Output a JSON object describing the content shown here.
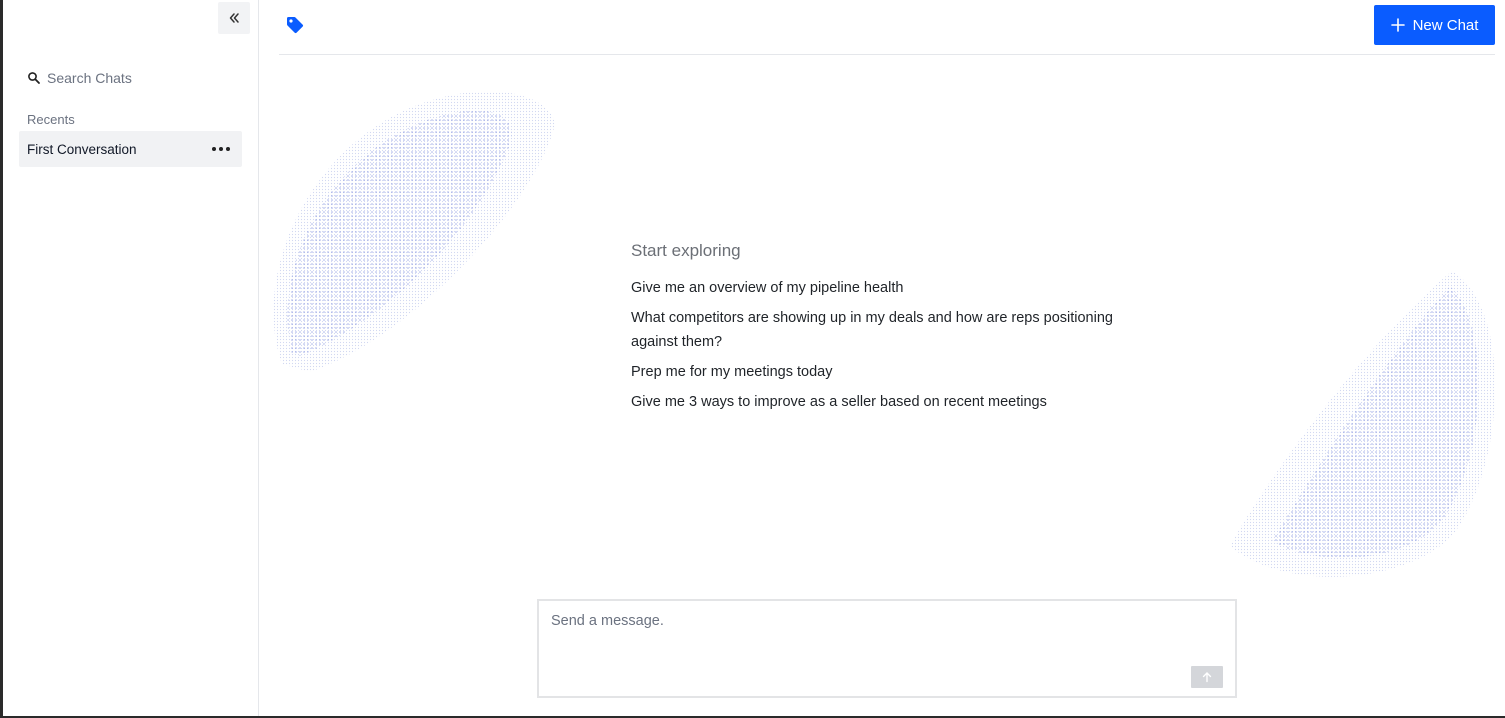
{
  "sidebar": {
    "collapse_icon": "chevrons-left-icon",
    "search_placeholder": "Search Chats",
    "recents_label": "Recents",
    "conversations": [
      {
        "title": "First Conversation"
      }
    ]
  },
  "header": {
    "tag_icon": "tag-icon",
    "new_chat_label": "New Chat"
  },
  "main": {
    "explore_heading": "Start exploring",
    "prompts": [
      "Give me an overview of my pipeline health",
      "What competitors are showing up in my deals and how are reps positioning against them?",
      "Prep me for my meetings today",
      "Give me 3 ways to improve as a seller based on recent meetings"
    ]
  },
  "composer": {
    "placeholder": "Send a message.",
    "value": ""
  },
  "colors": {
    "accent": "#0a5cff",
    "send_button_disabled": "#d4d6da",
    "deco_dots": "#5b6fd6"
  }
}
